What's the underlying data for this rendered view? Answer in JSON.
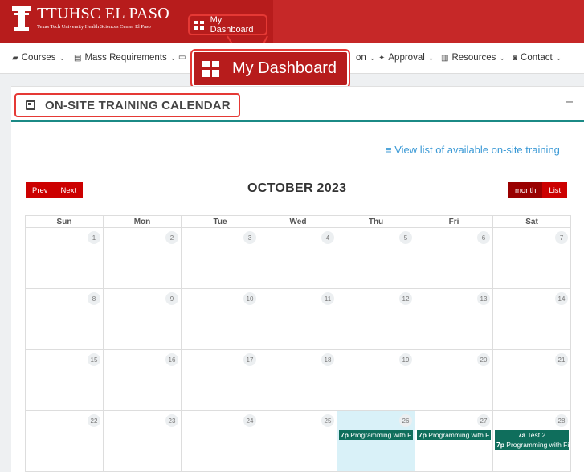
{
  "header": {
    "logo_title": "TTUHSC EL PASO",
    "logo_subtitle": "Texas Tech University Health Sciences Center El Paso",
    "dashboard_label": "My Dashboard",
    "brand_color": "#b71c1c",
    "highlight_color": "#e53935"
  },
  "nav": {
    "items": [
      {
        "label": "Courses",
        "icon": "courses-icon"
      },
      {
        "label": "Mass Requirements",
        "icon": "list-icon"
      },
      {
        "label": "on",
        "icon": ""
      },
      {
        "label": "Approval",
        "icon": "approval-icon"
      },
      {
        "label": "Resources",
        "icon": "resources-icon"
      },
      {
        "label": "Contact",
        "icon": "contact-icon"
      }
    ],
    "zoom_dashboard_label": "My Dashboard"
  },
  "panel": {
    "title": "ON-SITE TRAINING CALENDAR",
    "collapse_symbol": "–",
    "view_list_link": "View list of available on-site training"
  },
  "calendar": {
    "prev_label": "Prev",
    "next_label": "Next",
    "month_title": "OCTOBER 2023",
    "month_label": "month",
    "list_label": "List",
    "weekdays": [
      "Sun",
      "Mon",
      "Tue",
      "Wed",
      "Thu",
      "Fri",
      "Sat"
    ],
    "weeks": [
      [
        "1",
        "2",
        "3",
        "4",
        "5",
        "6",
        "7"
      ],
      [
        "8",
        "9",
        "10",
        "11",
        "12",
        "13",
        "14"
      ],
      [
        "15",
        "16",
        "17",
        "18",
        "19",
        "20",
        "21"
      ],
      [
        "22",
        "23",
        "24",
        "25",
        "26",
        "27",
        "28"
      ]
    ],
    "today": "26",
    "events": [
      {
        "day": "26",
        "time": "7p",
        "title": "Programming with F"
      },
      {
        "day": "27",
        "time": "7p",
        "title": "Programming with F"
      },
      {
        "day": "28",
        "time": "7a",
        "title": "Test 2"
      },
      {
        "day": "28",
        "time": "7p",
        "title": "Programming with Fi"
      }
    ],
    "event_color": "#0f6e5c",
    "today_color": "#d9f1f8"
  }
}
